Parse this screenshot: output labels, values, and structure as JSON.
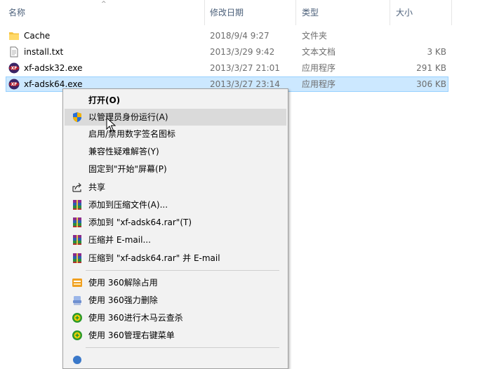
{
  "header": {
    "name": "名称",
    "date_modified": "修改日期",
    "type": "类型",
    "size": "大小"
  },
  "files": [
    {
      "name": "Cache",
      "date": "2018/9/4 9:27",
      "type": "文件夹",
      "size": "",
      "icon": "folder-icon"
    },
    {
      "name": "install.txt",
      "date": "2013/3/29 9:42",
      "type": "文本文档",
      "size": "3 KB",
      "icon": "text-file-icon"
    },
    {
      "name": "xf-adsk32.exe",
      "date": "2013/3/27 21:01",
      "type": "应用程序",
      "size": "291 KB",
      "icon": "xforce-exe-icon"
    },
    {
      "name": "xf-adsk64.exe",
      "date": "2013/3/27 23:14",
      "type": "应用程序",
      "size": "306 KB",
      "icon": "xforce-exe-icon",
      "selected": true
    }
  ],
  "context_menu": {
    "open": "打开(O)",
    "run_as_admin": "以管理员身份运行(A)",
    "toggle_signature": "启用/禁用数字签名图标",
    "troubleshoot_compat": "兼容性疑难解答(Y)",
    "pin_start": "固定到\"开始\"屏幕(P)",
    "share": "共享",
    "add_archive": "添加到压缩文件(A)...",
    "add_rar": "添加到 \"xf-adsk64.rar\"(T)",
    "compress_email": "压缩并 E-mail...",
    "compress_rar_email": "压缩到 \"xf-adsk64.rar\" 并 E-mail",
    "unlock_360": "使用 360解除占用",
    "force_delete_360": "使用 360强力删除",
    "trojan_scan_360": "使用 360进行木马云查杀",
    "manage_menu_360": "使用 360管理右键菜单"
  },
  "colors": {
    "selection_bg": "#cce8ff",
    "selection_border": "#99d1ff",
    "menu_bg": "#f2f2f2",
    "menu_highlight": "#dadada"
  }
}
